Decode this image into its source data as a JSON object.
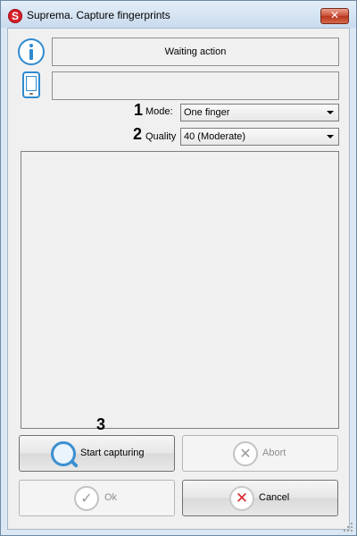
{
  "window": {
    "title": "Suprema. Capture fingerprints",
    "app_icon_letter": "S",
    "close_glyph": "✕"
  },
  "status": {
    "message": "Waiting action",
    "device_message": "",
    "info_icon": "info-icon",
    "device_icon": "device-icon"
  },
  "settings": {
    "mode_marker": "1",
    "mode_label": "Mode:",
    "mode_value": "One finger",
    "quality_marker": "2",
    "quality_label": "Quality",
    "quality_value": "40 (Moderate)"
  },
  "buttons": {
    "start_marker": "3",
    "start_label": "Start capturing",
    "abort_label": "Abort",
    "ok_label": "Ok",
    "cancel_label": "Cancel",
    "abort_glyph": "✕",
    "ok_glyph": "✓",
    "cancel_glyph": "✕"
  },
  "colors": {
    "accent": "#2f8ad0",
    "cancel_red": "#d8272d",
    "brand_red": "#d51f2a"
  }
}
